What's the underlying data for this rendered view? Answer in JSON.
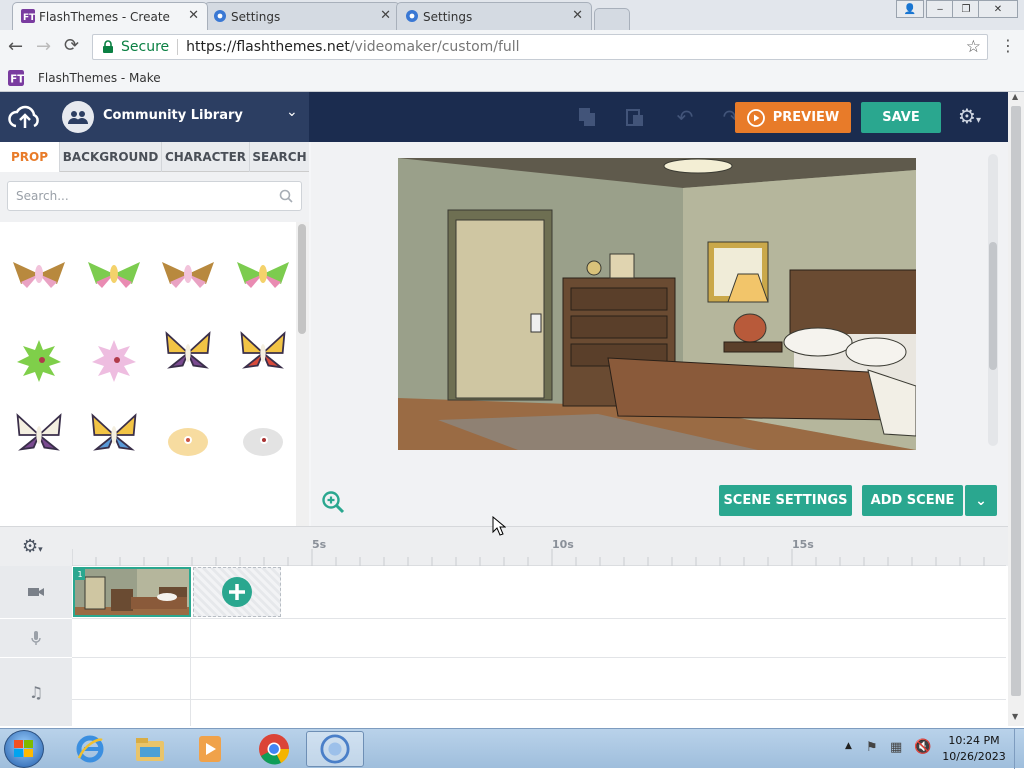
{
  "browser": {
    "tabs": [
      {
        "title": "FlashThemes - Create",
        "active": true
      },
      {
        "title": "Settings",
        "active": false
      },
      {
        "title": "Settings",
        "active": false
      }
    ],
    "security_label": "Secure",
    "url_base": "https://flashthemes.net",
    "url_path": "/videomaker/custom/full",
    "bookmark": "FlashThemes - Make"
  },
  "app": {
    "library_name": "Community Library",
    "preview_label": "PREVIEW",
    "save_label": "SAVE",
    "category_tabs": [
      "PROP",
      "BACKGROUND",
      "CHARACTER",
      "SEARCH"
    ],
    "active_category": "PROP",
    "search_placeholder": "Search...",
    "scene_settings_label": "SCENE SETTINGS",
    "add_scene_label": "ADD SCENE",
    "timeline_marks": [
      "5s",
      "10s",
      "15s"
    ],
    "scene_number": "1",
    "colors": {
      "accent_orange": "#e87b29",
      "accent_green": "#2aa78f",
      "topbar": "#1b2c4f"
    }
  },
  "taskbar": {
    "time": "10:24 PM",
    "date": "10/26/2023"
  }
}
